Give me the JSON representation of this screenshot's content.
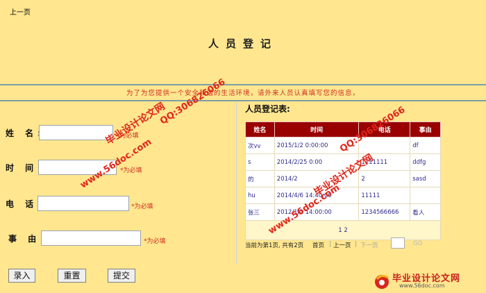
{
  "nav": {
    "prev_page": "上一页"
  },
  "page_title": "人员登记",
  "notice": "为了为您提供一个安全和谐的生活环境，请外来人员认真填写您的信息，",
  "form": {
    "fields": [
      {
        "label": "姓 名:",
        "value": "",
        "required": "*为必填"
      },
      {
        "label": "时 间:",
        "value": "",
        "required": "*为必填"
      },
      {
        "label": "电 话:",
        "value": "",
        "required": "*为必填"
      },
      {
        "label": "事 由:",
        "value": "",
        "required": "*为必填"
      }
    ]
  },
  "table": {
    "title": "人员登记表:",
    "columns": [
      "姓名",
      "时间",
      "电话",
      "事由"
    ],
    "rows": [
      [
        "次vv",
        "2015/1/2 0:00:00",
        "",
        "df"
      ],
      [
        "s",
        "2014/2/25 0:00",
        "1111111",
        "ddfg"
      ],
      [
        "的",
        "2014/2",
        "2",
        "sasd"
      ],
      [
        "hu",
        "2014/4/6 14:40:00",
        "11111",
        ""
      ],
      [
        "张三",
        "2012/1/2 14:00:00",
        "1234566666",
        "看人"
      ]
    ],
    "pager_pages": "1 2"
  },
  "pager": {
    "status": "当前为第1页, 共有2页",
    "first": "首页",
    "prev": "上一页",
    "next": "下一页",
    "input_value": "",
    "go": "GO"
  },
  "buttons": {
    "enter": "录入",
    "reset": "重置",
    "submit": "提交"
  },
  "watermarks": {
    "brand": "毕业设计论文网",
    "qq": "QQ:306826066",
    "url": "www.56doc.com"
  },
  "colors": {
    "background": "#FFE68F",
    "header": "#990000",
    "accent_red": "#CC2E1F",
    "divider": "#7C9EA6"
  }
}
